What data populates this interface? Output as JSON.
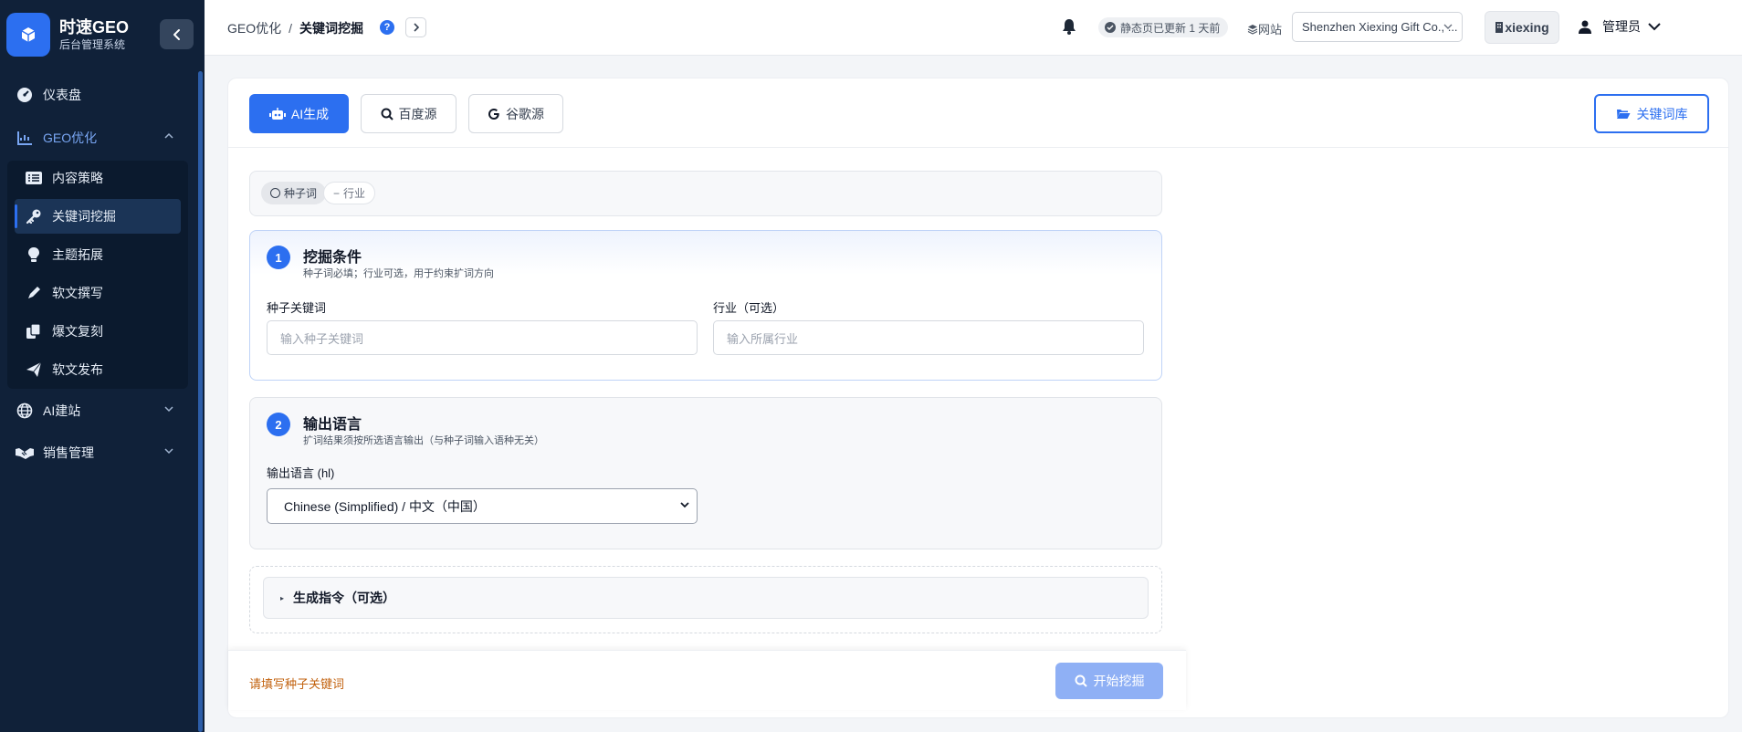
{
  "brand": {
    "name": "时速GEO",
    "subtitle": "后台管理系统"
  },
  "sidebar": {
    "items": [
      {
        "label": "仪表盘",
        "icon": "gauge-icon"
      },
      {
        "label": "GEO优化",
        "icon": "chart-line-icon",
        "expanded": true
      },
      {
        "label": "AI建站",
        "icon": "globe-icon"
      },
      {
        "label": "销售管理",
        "icon": "handshake-icon"
      }
    ],
    "geo_children": [
      {
        "label": "内容策略",
        "icon": "list-icon"
      },
      {
        "label": "关键词挖掘",
        "icon": "key-icon",
        "active": true
      },
      {
        "label": "主题拓展",
        "icon": "lightbulb-icon"
      },
      {
        "label": "软文撰写",
        "icon": "pen-icon"
      },
      {
        "label": "爆文复刻",
        "icon": "copy-icon"
      },
      {
        "label": "软文发布",
        "icon": "paper-plane-icon"
      }
    ]
  },
  "header": {
    "breadcrumb_parent": "GEO优化",
    "breadcrumb_sep": "/",
    "breadcrumb_current": "关键词挖掘",
    "help": "?",
    "update_status": "静态页已更新 1 天前",
    "site_label": "网站",
    "site_value": "Shenzhen Xiexing Gift Co., ...",
    "site_tag": "xiexing",
    "user_name": "管理员"
  },
  "tabs": [
    {
      "label": "AI生成",
      "icon": "robot-icon",
      "active": true
    },
    {
      "label": "百度源",
      "icon": "search-icon"
    },
    {
      "label": "谷歌源",
      "icon": "google-icon"
    }
  ],
  "library_button": "关键词库",
  "chips": [
    {
      "label": "种子词",
      "selected": true
    },
    {
      "label": "行业",
      "selected": false
    }
  ],
  "section1": {
    "number": "1",
    "title": "挖掘条件",
    "subtitle": "种子词必填；行业可选，用于约束扩词方向",
    "seed_label": "种子关键词",
    "seed_placeholder": "输入种子关键词",
    "industry_label": "行业（可选）",
    "industry_placeholder": "输入所属行业"
  },
  "section2": {
    "number": "2",
    "title": "输出语言",
    "subtitle": "扩词结果须按所选语言输出（与种子词输入语种无关）",
    "field_label": "输出语言 (hl)",
    "selected_language": "Chinese (Simplified) / 中文（中国）"
  },
  "generation": {
    "label": "生成指令（可选）",
    "toggle": "▸"
  },
  "footer": {
    "warning": "请填写种子关键词",
    "start_button": "开始挖掘"
  },
  "colors": {
    "primary": "#2c6ff0",
    "sidebar_bg": "#102139",
    "warning": "#c2620f",
    "disabled_btn": "#8fb0f5"
  }
}
